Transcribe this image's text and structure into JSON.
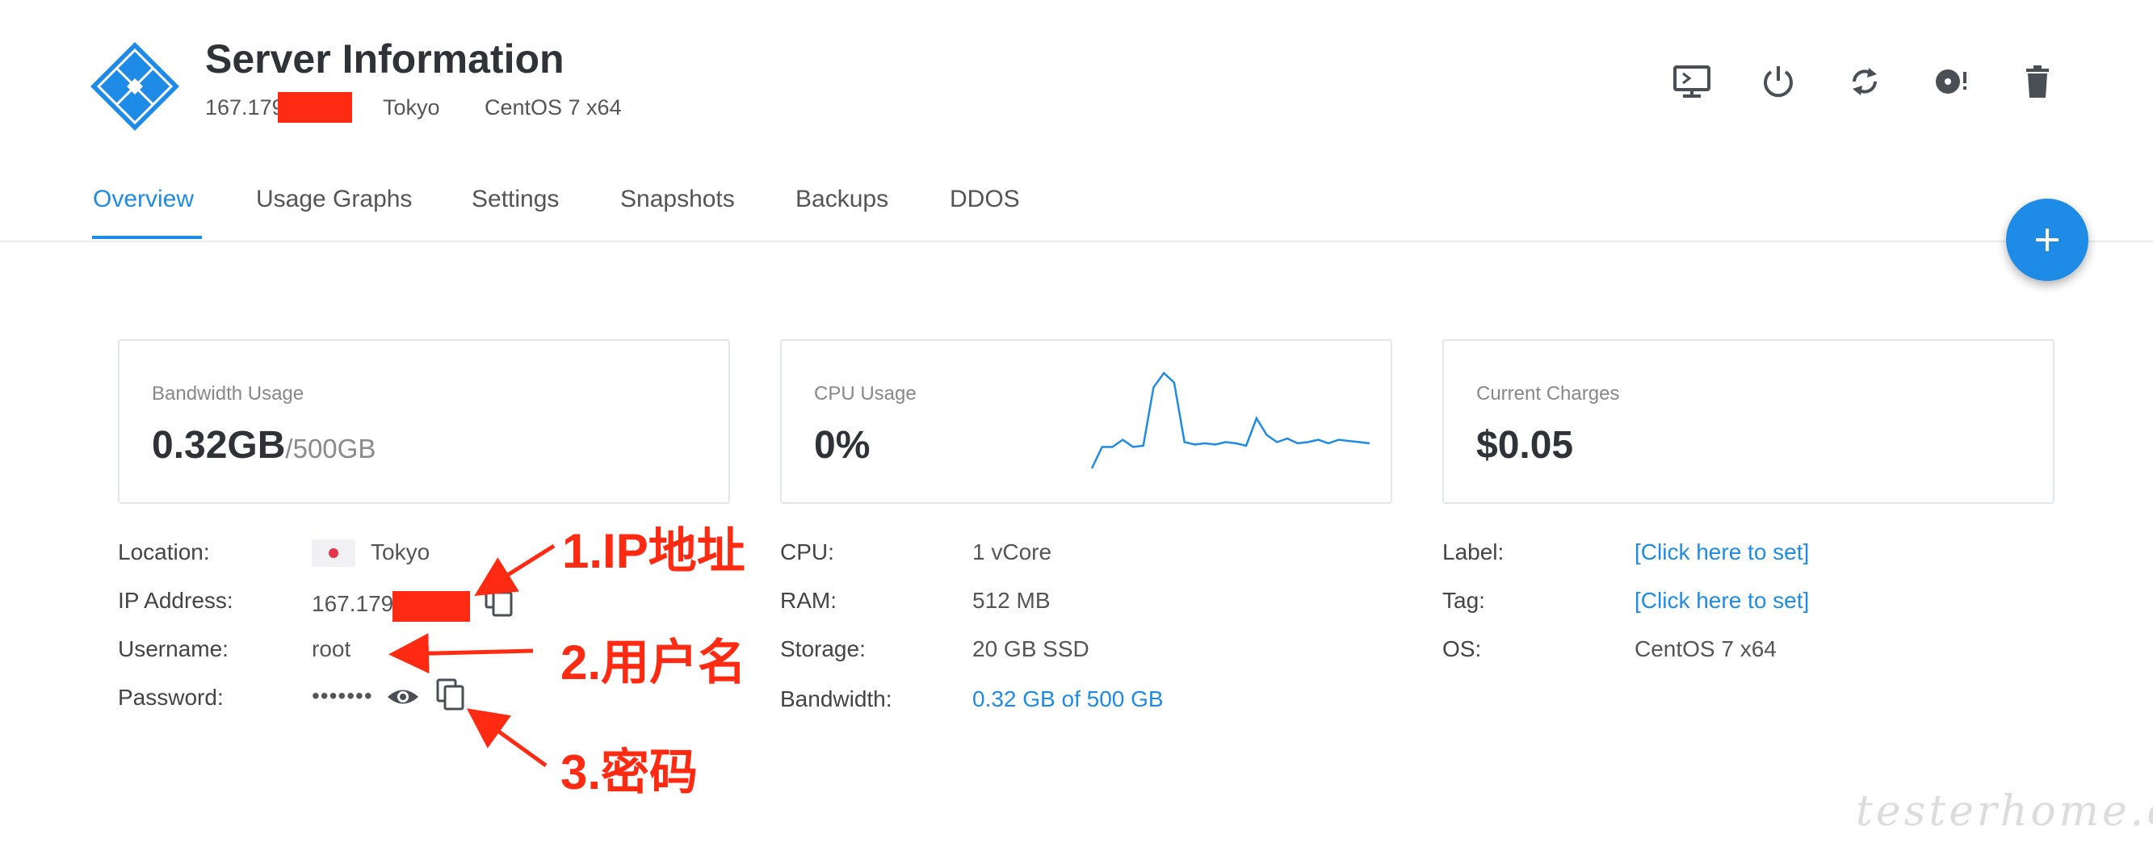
{
  "header": {
    "title": "Server Information",
    "ip_prefix": "167.179.",
    "location": "Tokyo",
    "os": "CentOS 7 x64"
  },
  "toolbar": {
    "icons": [
      "console-icon",
      "power-icon",
      "restart-icon",
      "reinstall-icon",
      "delete-icon"
    ]
  },
  "tabs": [
    {
      "label": "Overview",
      "active": true
    },
    {
      "label": "Usage Graphs"
    },
    {
      "label": "Settings"
    },
    {
      "label": "Snapshots"
    },
    {
      "label": "Backups"
    },
    {
      "label": "DDOS"
    }
  ],
  "fab": {
    "label": "+"
  },
  "cards": {
    "bandwidth": {
      "label": "Bandwidth Usage",
      "value": "0.32GB",
      "limit": "/500GB"
    },
    "cpu": {
      "label": "CPU Usage",
      "value": "0%",
      "sparkline": [
        0,
        18,
        18,
        24,
        18,
        19,
        68,
        80,
        72,
        22,
        20,
        21,
        20,
        22,
        21,
        19,
        42,
        28,
        22,
        25,
        21,
        22,
        24,
        21,
        24,
        23,
        22,
        21
      ]
    },
    "charges": {
      "label": "Current Charges",
      "value": "$0.05"
    }
  },
  "details_left": {
    "location_label": "Location:",
    "location_value": "Tokyo",
    "ip_label": "IP Address:",
    "ip_value": "167.179.",
    "username_label": "Username:",
    "username_value": "root",
    "password_label": "Password:",
    "password_value": "•••••••"
  },
  "details_mid": {
    "cpu_label": "CPU:",
    "cpu_value": "1 vCore",
    "ram_label": "RAM:",
    "ram_value": "512 MB",
    "storage_label": "Storage:",
    "storage_value": "20 GB SSD",
    "bandwidth_label": "Bandwidth:",
    "bandwidth_value": "0.32 GB of 500 GB"
  },
  "details_right": {
    "label_label": "Label:",
    "label_value": "[Click here to set]",
    "tag_label": "Tag:",
    "tag_value": "[Click here to set]",
    "os_label": "OS:",
    "os_value": "CentOS 7 x64"
  },
  "annotations": {
    "a1": "1.IP地址",
    "a2": "2.用户名",
    "a3": "3.密码"
  },
  "watermark": "testerhome.com",
  "colors": {
    "accent": "#1e8be6",
    "annotation": "#ff2a12",
    "redaction": "#ff2a12"
  }
}
